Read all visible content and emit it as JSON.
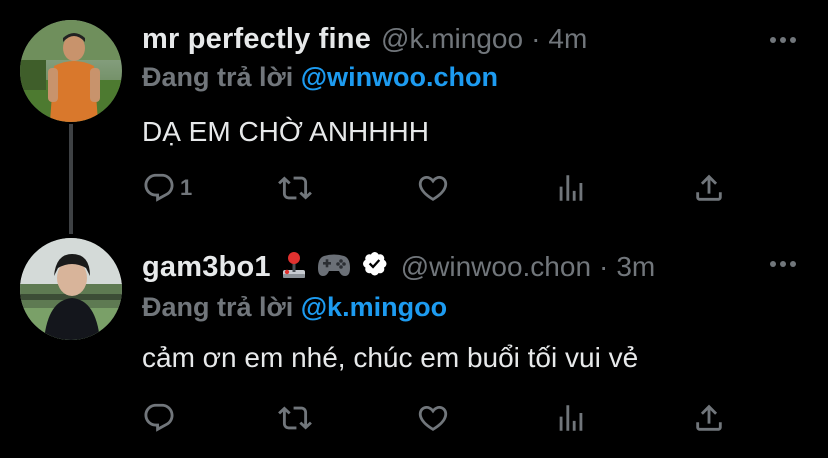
{
  "tweets": [
    {
      "display_name": "mr perfectly fine",
      "handle": "@k.mingoo",
      "separator": "·",
      "time": "4m",
      "reply_prefix": "Đang trả lời",
      "reply_to": "@winwoo.chon",
      "text": "DẠ EM CHỜ ANHHHH",
      "reply_count": "1",
      "retweet_count": "",
      "like_count": "",
      "verified": false
    },
    {
      "display_name": "gam3bo1",
      "emojis": [
        "joystick-emoji",
        "gamepad-emoji"
      ],
      "handle": "@winwoo.chon",
      "separator": "·",
      "time": "3m",
      "reply_prefix": "Đang trả lời",
      "reply_to": "@k.mingoo",
      "text": "cảm ơn em nhé, chúc em buổi tối vui vẻ",
      "reply_count": "",
      "retweet_count": "",
      "like_count": "",
      "verified": true
    }
  ],
  "colors": {
    "background": "#000000",
    "primary_text": "#e7e9ea",
    "secondary_text": "#71767b",
    "accent": "#1d9bf0",
    "thread_line": "#3e4144"
  },
  "icons": [
    "reply-icon",
    "retweet-icon",
    "like-icon",
    "analytics-icon",
    "share-icon",
    "more-icon",
    "verified-icon"
  ]
}
